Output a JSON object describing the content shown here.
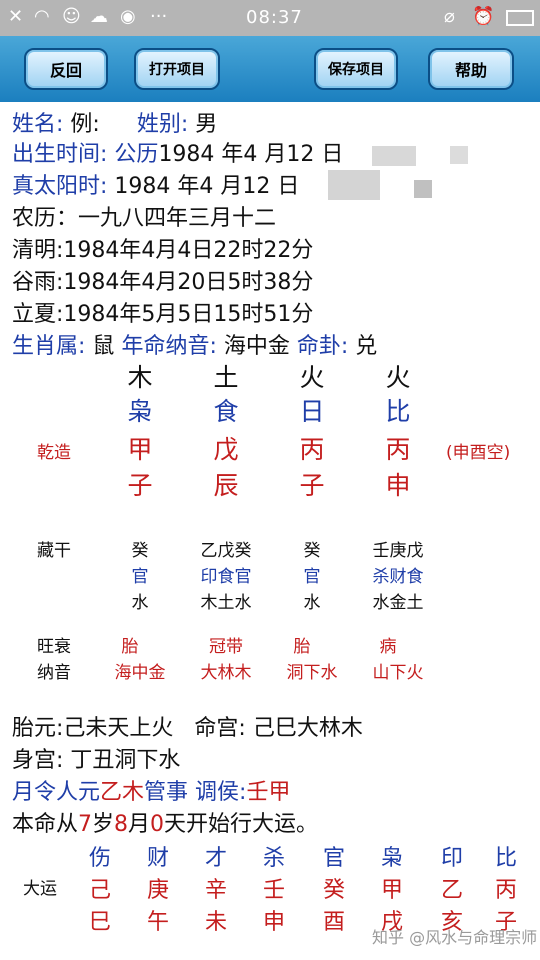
{
  "status": {
    "time": "08:37"
  },
  "toolbar": {
    "back": "反回",
    "open": "打开项目",
    "save": "保存项目",
    "help": "帮助"
  },
  "info": {
    "name_label": "姓名:",
    "name_value": "例:",
    "gender_label": "姓别:",
    "gender_value": "男",
    "birth_label": "出生时间:",
    "birth_cal": "公历",
    "birth_value": "1984 年4 月12 日",
    "solar_label": "真太阳时:",
    "solar_value": "1984 年4 月12 日",
    "lunar": "农历：一九八四年三月十二",
    "qingming": "清明:1984年4月4日22时22分",
    "guyu": "谷雨:1984年4月20日5时38分",
    "lixia": "立夏:1984年5月5日15时51分",
    "zodiac_label": "生肖属:",
    "zodiac_value": "鼠",
    "nayin_label": "年命纳音:",
    "nayin_value": "海中金",
    "gua_label": "命卦:",
    "gua_value": "兑"
  },
  "pillars": {
    "label": "乾造",
    "void_note": "(申酉空)",
    "elements": [
      "木",
      "土",
      "火",
      "火"
    ],
    "gods": [
      "枭",
      "食",
      "日",
      "比"
    ],
    "stems": [
      "甲",
      "戊",
      "丙",
      "丙"
    ],
    "branches": [
      "子",
      "辰",
      "子",
      "申"
    ]
  },
  "hidden": {
    "label": "藏干",
    "stems": [
      "癸",
      "乙戊癸",
      "癸",
      "壬庚戊"
    ],
    "gods": [
      "官",
      "印食官",
      "官",
      "杀财食"
    ],
    "elements": [
      "水",
      "木土水",
      "水",
      "水金土"
    ]
  },
  "strength": {
    "label": "旺衰",
    "values": [
      "胎",
      "冠带",
      "胎",
      "病"
    ]
  },
  "nayin": {
    "label": "纳音",
    "values": [
      "海中金",
      "大林木",
      "洞下水",
      "山下火"
    ]
  },
  "extra": {
    "taiyuan": "胎元:己未天上火",
    "minggong": "命宫: 己巳大林木",
    "shengong": "身宫: 丁丑洞下水",
    "yueling_a": "月令人元",
    "yueling_b": "乙木",
    "yueling_c": "管事 调侯:",
    "yueling_d": "壬甲",
    "start_a": "本命从",
    "start_age": "7",
    "start_b": "岁",
    "start_month": "8",
    "start_c": "月",
    "start_day": "0",
    "start_d": "天开始行大运。"
  },
  "dayun": {
    "label": "大运",
    "gods": [
      "伤",
      "财",
      "才",
      "杀",
      "官",
      "枭",
      "印",
      "比"
    ],
    "stems": [
      "己",
      "庚",
      "辛",
      "壬",
      "癸",
      "甲",
      "乙",
      "丙"
    ],
    "branches": [
      "巳",
      "午",
      "未",
      "申",
      "酉",
      "戌",
      "亥",
      "子"
    ]
  },
  "watermark": "知乎 @风水与命理宗师"
}
